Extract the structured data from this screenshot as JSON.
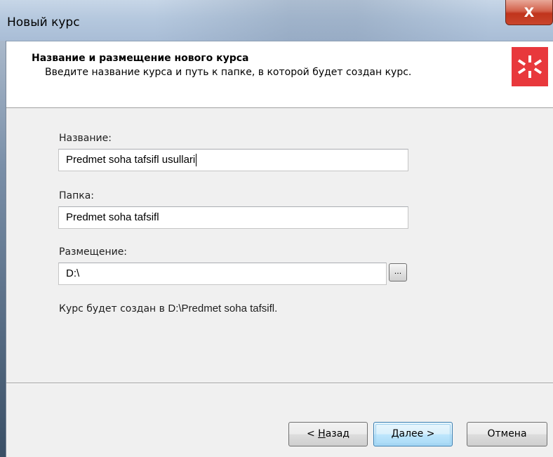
{
  "window": {
    "title": "Новый курс",
    "close_glyph": "X"
  },
  "header": {
    "title": "Название и размещение нового курса",
    "subtitle": "Введите название курса и путь к папке, в которой будет создан курс."
  },
  "form": {
    "name_label": "Название:",
    "name_value": "Predmet soha tafsifl usullari",
    "folder_label": "Папка:",
    "folder_value": "Predmet soha tafsifl",
    "location_label": "Размещение:",
    "location_value": "D:\\",
    "browse_label": "..."
  },
  "status": {
    "prefix": "Курс будет создан в ",
    "path": "D:\\Predmet soha tafsifl."
  },
  "buttons": {
    "back": {
      "pre": "< ",
      "accel": "Н",
      "rest": "азад"
    },
    "next": {
      "pre": "",
      "accel": "Д",
      "rest": "алее >"
    },
    "cancel": "Отмена"
  },
  "colors": {
    "logo": "#e8383c",
    "close": "#c9452c",
    "default_button": "#bee6fd"
  },
  "icons": {
    "logo": "ispring-star-icon",
    "close": "close-icon"
  }
}
